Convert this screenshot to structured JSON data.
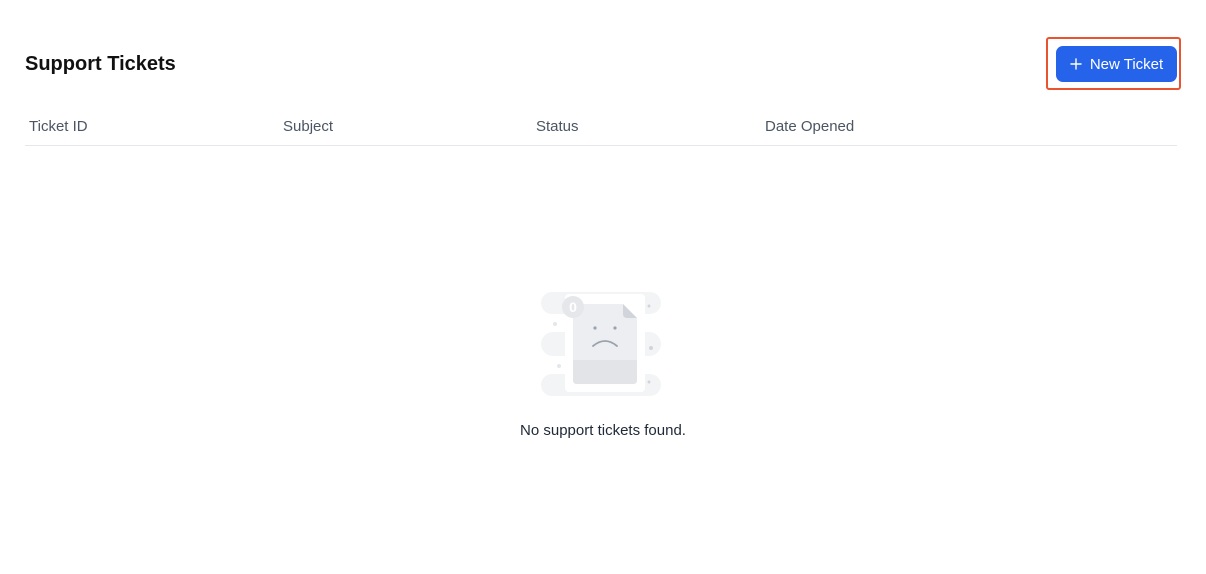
{
  "header": {
    "title": "Support Tickets",
    "new_ticket_label": "New Ticket"
  },
  "table": {
    "columns": [
      "Ticket ID",
      "Subject",
      "Status",
      "Date Opened"
    ],
    "rows": []
  },
  "empty_state": {
    "badge_count": "0",
    "message": "No support tickets found."
  },
  "colors": {
    "accent": "#2563eb",
    "highlight": "#e8542f"
  },
  "icons": {
    "new_ticket": "plus-icon",
    "empty_state": "sad-document-icon"
  }
}
